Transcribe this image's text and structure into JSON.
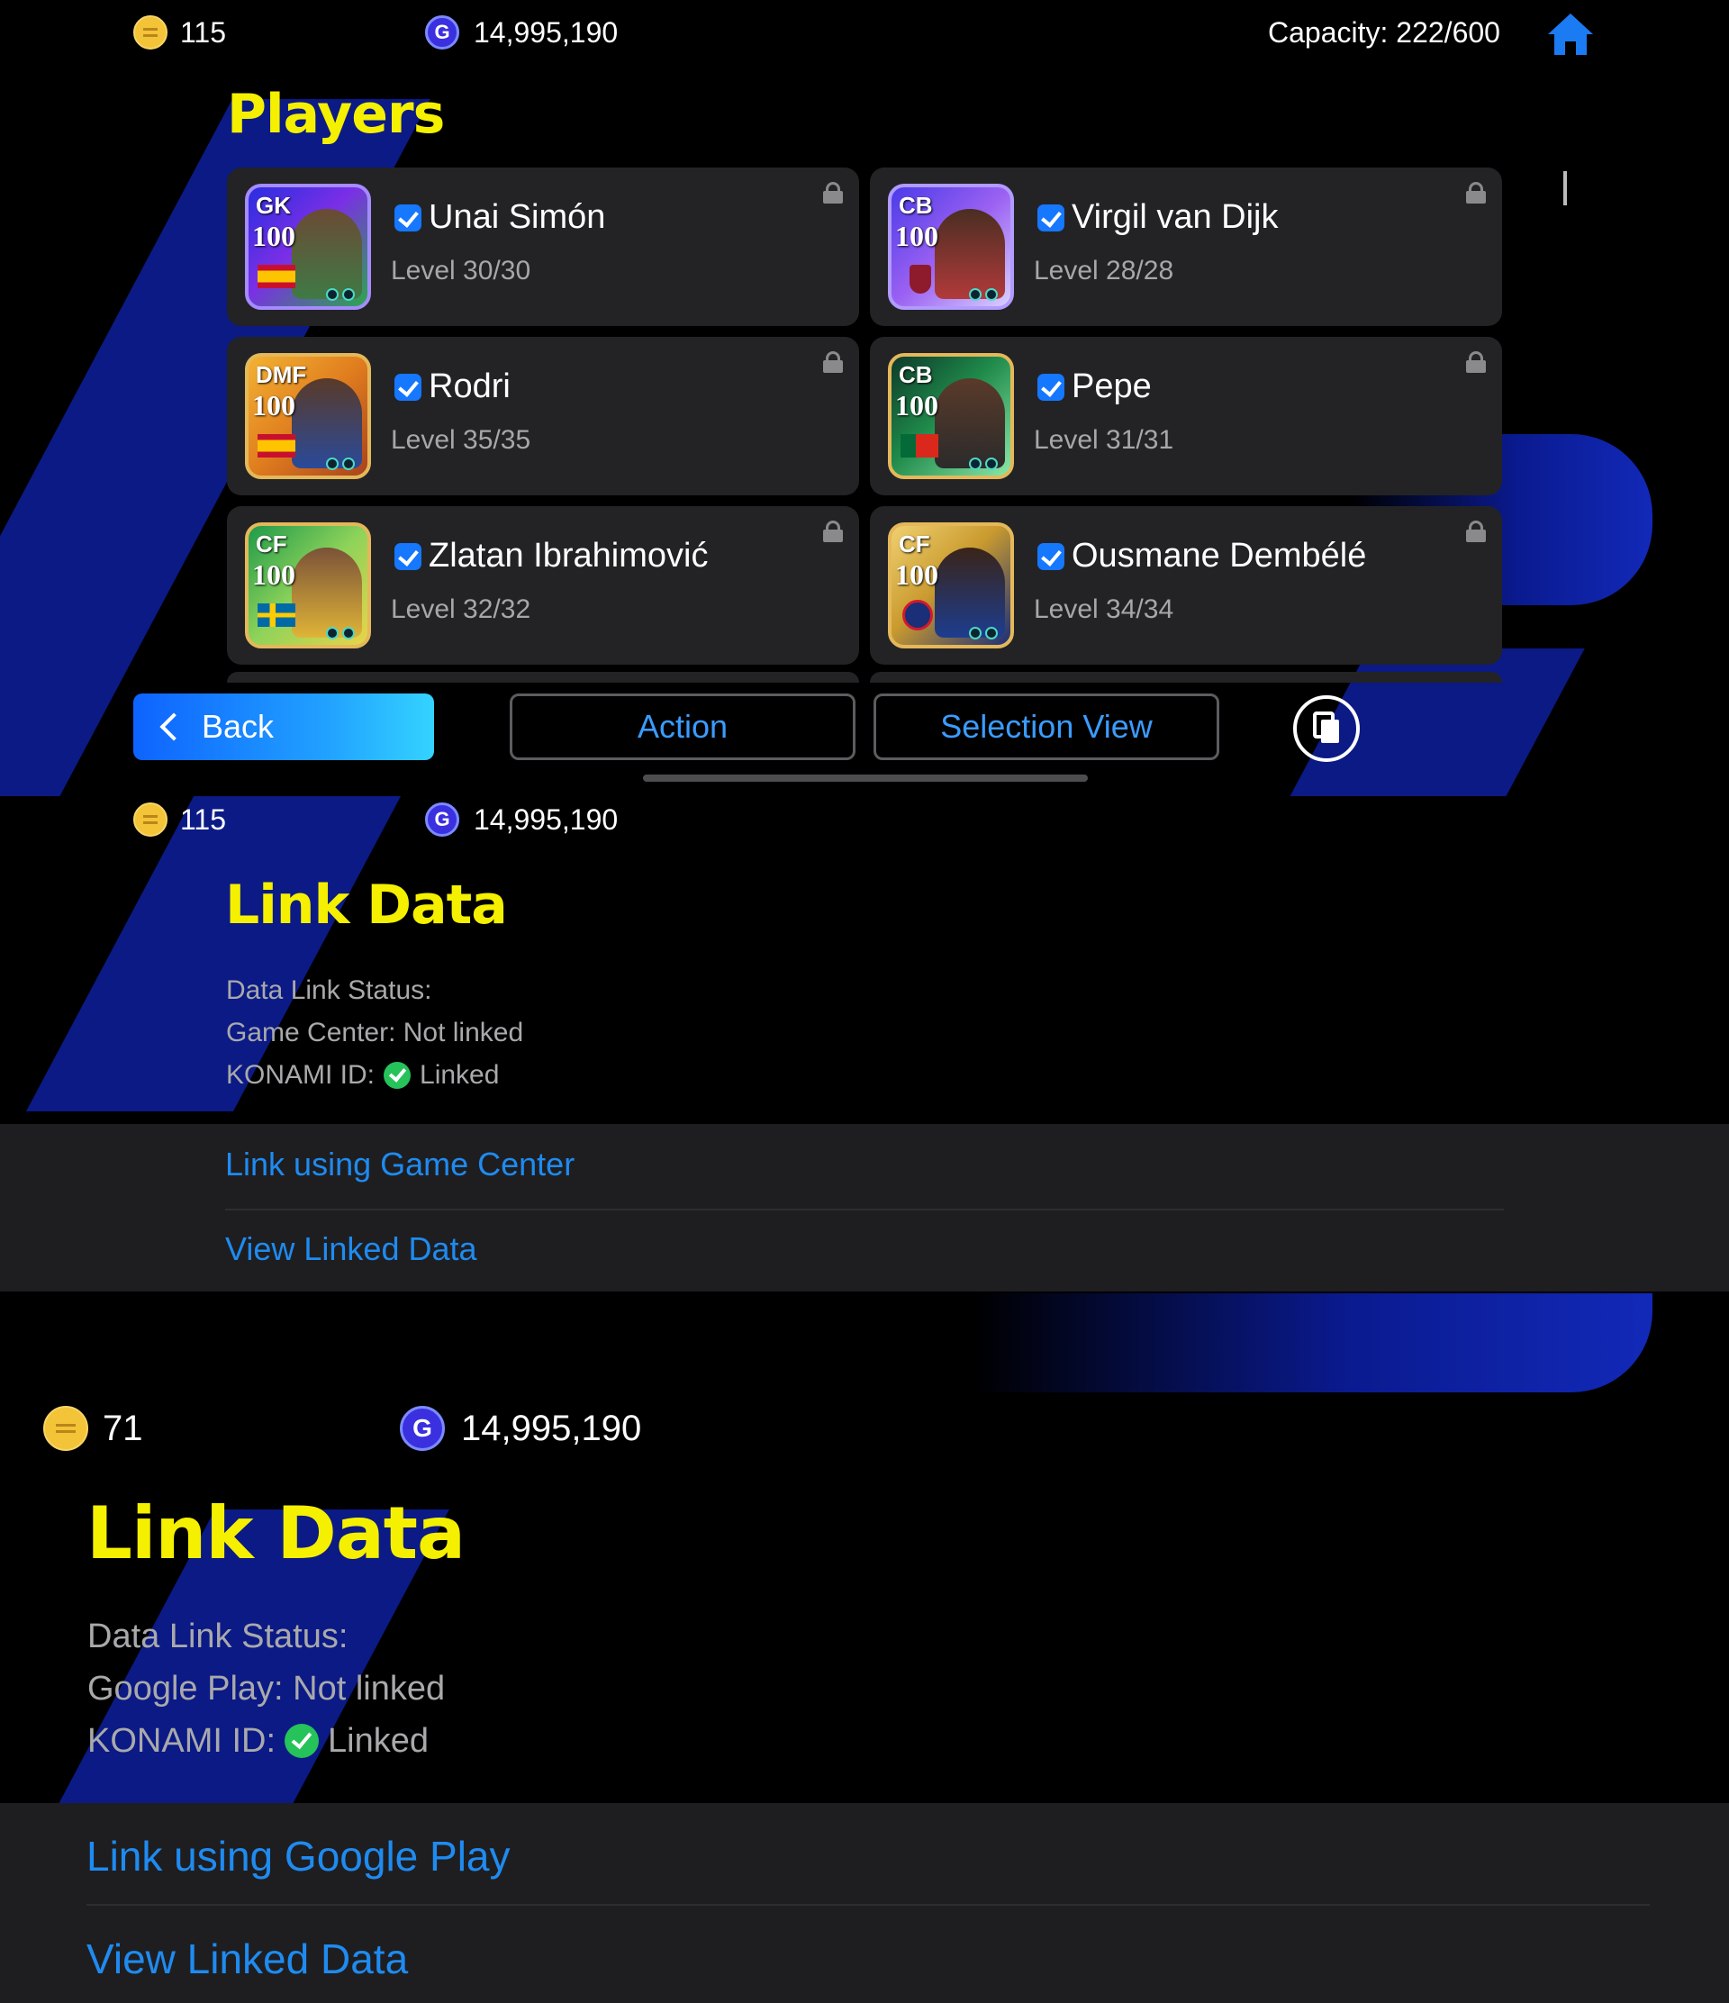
{
  "screen1": {
    "coins": "115",
    "gp": "14,995,190",
    "capacity": "Capacity: 222/600",
    "title": "Players",
    "players": [
      {
        "position": "GK",
        "rating": "100",
        "name": "Unai Simón",
        "level": "Level 30/30"
      },
      {
        "position": "CB",
        "rating": "100",
        "name": "Virgil van Dijk",
        "level": "Level 28/28"
      },
      {
        "position": "DMF",
        "rating": "100",
        "name": "Rodri",
        "level": "Level 35/35"
      },
      {
        "position": "CB",
        "rating": "100",
        "name": "Pepe",
        "level": "Level 31/31"
      },
      {
        "position": "CF",
        "rating": "100",
        "name": "Zlatan Ibrahimović",
        "level": "Level 32/32"
      },
      {
        "position": "CF",
        "rating": "100",
        "name": "Ousmane Dembélé",
        "level": "Level 34/34"
      }
    ],
    "back_label": "Back",
    "action_label": "Action",
    "selection_view_label": "Selection View",
    "gp_symbol": "G",
    "icons": [
      "coin-icon",
      "gp-icon",
      "home-icon",
      "lock-icon",
      "check-icon",
      "copy-icon",
      "chevron-left-icon"
    ]
  },
  "screen2": {
    "coins": "115",
    "gp": "14,995,190",
    "title": "Link Data",
    "status_heading": "Data Link Status:",
    "status_line1": "Game Center: Not linked",
    "konami_label": "KONAMI ID:",
    "konami_value": "Linked",
    "link_option": "Link using Game Center",
    "view_option": "View Linked Data"
  },
  "screen3": {
    "coins": "71",
    "gp": "14,995,190",
    "title": "Link Data",
    "status_heading": "Data Link Status:",
    "status_line1": "Google Play: Not linked",
    "konami_label": "KONAMI ID:",
    "konami_value": "Linked",
    "link_option": "Link using Google Play",
    "view_option": "View Linked Data"
  },
  "colors": {
    "title_yellow": "#f5f000",
    "link_blue": "#1f8bf0",
    "accent_blue": "#0b1a85",
    "linked_green": "#25c35a"
  }
}
